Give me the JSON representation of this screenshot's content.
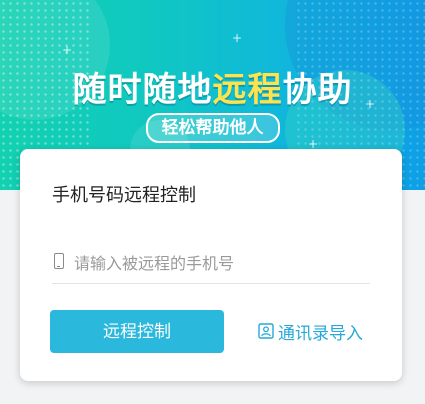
{
  "banner": {
    "headline_pre": "随时随地",
    "headline_highlight": "远程",
    "headline_post": "协助",
    "subtitle": "轻松帮助他人"
  },
  "card": {
    "title": "手机号码远程控制",
    "phone_input": {
      "placeholder": "请输入被远程的手机号",
      "value": ""
    },
    "remote_button_label": "远程控制",
    "contacts_link_label": "通讯录导入"
  },
  "colors": {
    "accent": "#2ab8dc",
    "link": "#25a9d8",
    "highlight": "#ffe34d"
  },
  "icons": {
    "phone": "phone-icon",
    "contacts": "contact-card-icon"
  }
}
